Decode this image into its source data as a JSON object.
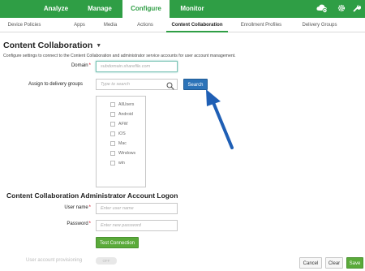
{
  "topnav": {
    "items": [
      {
        "label": "Analyze"
      },
      {
        "label": "Manage"
      },
      {
        "label": "Configure"
      },
      {
        "label": "Monitor"
      }
    ],
    "active": "Configure",
    "icons": [
      "cloud-settings-icon",
      "gear-icon",
      "wrench-icon"
    ]
  },
  "subnav": {
    "items": [
      {
        "label": "Device Policies"
      },
      {
        "label": "Apps"
      },
      {
        "label": "Media"
      },
      {
        "label": "Actions"
      },
      {
        "label": "Content Collaboration"
      },
      {
        "label": "Enrollment Profiles"
      },
      {
        "label": "Delivery Groups"
      }
    ],
    "active": "Content Collaboration"
  },
  "page": {
    "title": "Content Collaboration",
    "description": "Configure settings to connect to the Content Collaboration and administrator service accounts for user account management."
  },
  "domain": {
    "label": "Domain",
    "required_mark": "*",
    "placeholder": "subdomain.sharefile.com"
  },
  "delivery_groups": {
    "label": "Assign to delivery groups",
    "search_placeholder": "Type to search",
    "search_button": "Search",
    "items": [
      {
        "label": "AllUsers"
      },
      {
        "label": "Android"
      },
      {
        "label": "AFW"
      },
      {
        "label": "iOS"
      },
      {
        "label": "Mac"
      },
      {
        "label": "Windows"
      },
      {
        "label": "win"
      }
    ]
  },
  "admin": {
    "section_title": "Content Collaboration Administrator Account Logon",
    "username_label": "User name",
    "username_placeholder": "Enter user name",
    "password_label": "Password",
    "password_placeholder": "Enter new password",
    "required_mark": "*",
    "test_button": "Test Connection"
  },
  "provisioning": {
    "label": "User account provisioning",
    "toggle": "OFF"
  },
  "footer": {
    "cancel": "Cancel",
    "clear": "Clear",
    "save": "Save"
  },
  "colors": {
    "brand_green": "#2f9e45",
    "button_blue": "#2c73b8",
    "annotation_arrow": "#1f5fb5"
  }
}
